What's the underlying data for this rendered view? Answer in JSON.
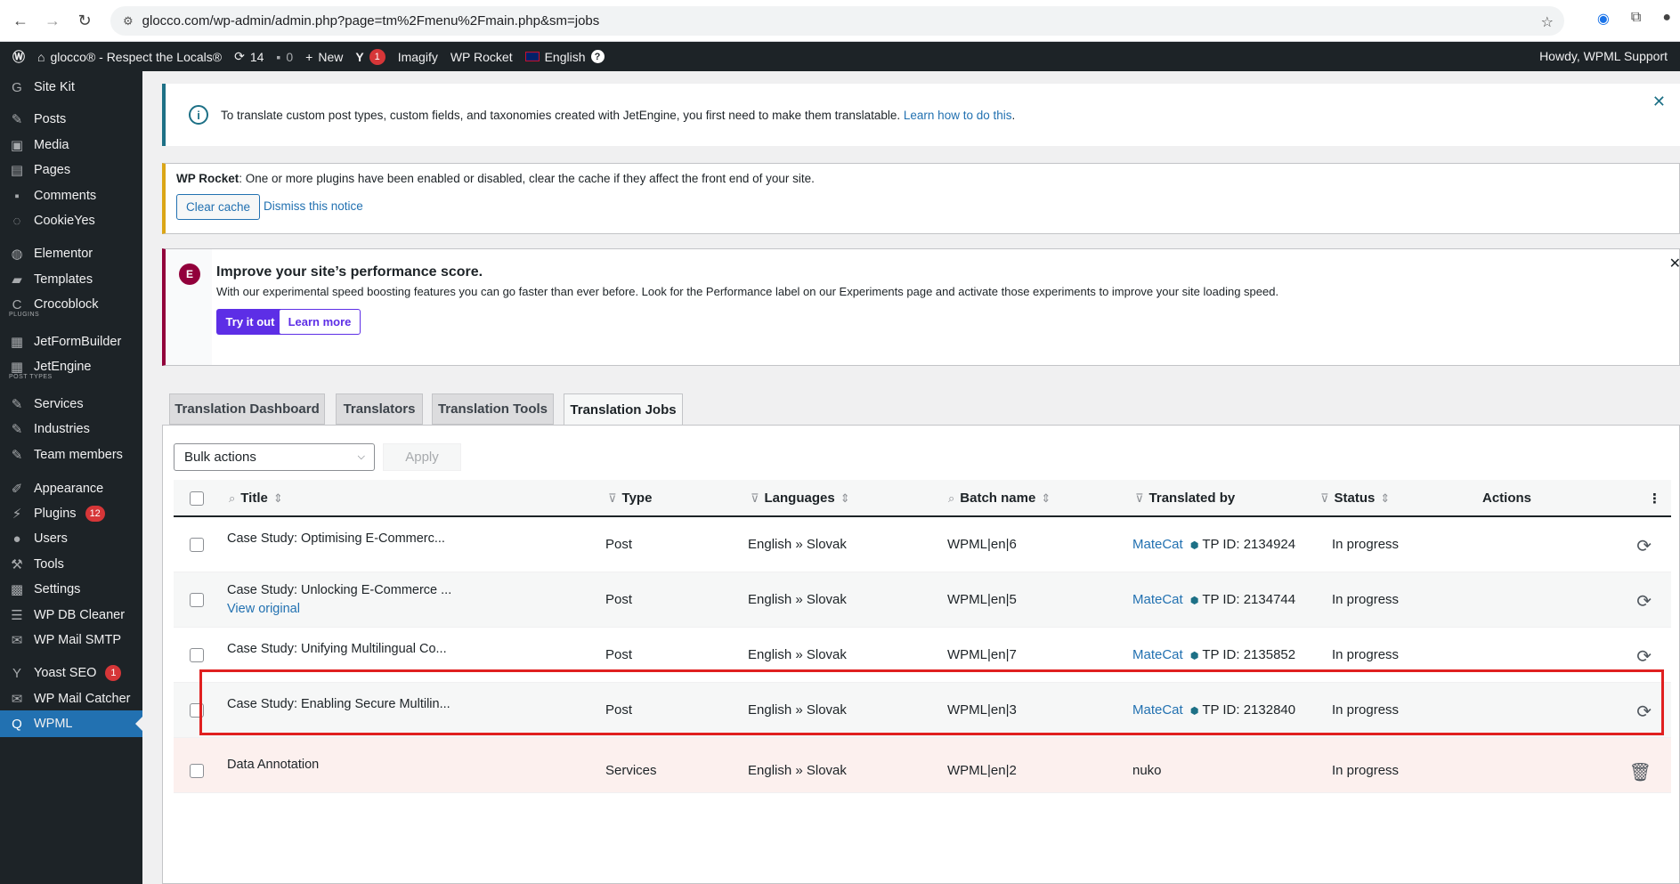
{
  "browser": {
    "url": "glocco.com/wp-admin/admin.php?page=tm%2Fmenu%2Fmain.php&sm=jobs"
  },
  "adminbar": {
    "site_name": "glocco® - Respect the Locals®",
    "updates_count": "14",
    "comments_count": "0",
    "new_label": "New",
    "yoast_badge": "1",
    "imagify": "Imagify",
    "wp_rocket": "WP Rocket",
    "language": "English",
    "howdy": "Howdy, WPML Support"
  },
  "sidebar": {
    "site_kit": "Site Kit",
    "posts": "Posts",
    "media": "Media",
    "pages": "Pages",
    "comments": "Comments",
    "cookieyes": "CookieYes",
    "elementor": "Elementor",
    "templates": "Templates",
    "crocoblock": "Crocoblock",
    "plugins_sep": "PLUGINS",
    "jetformbuilder": "JetFormBuilder",
    "jetengine": "JetEngine",
    "post_types_sep": "POST TYPES",
    "services": "Services",
    "industries": "Industries",
    "team_members": "Team members",
    "appearance": "Appearance",
    "plugins": "Plugins",
    "plugins_badge": "12",
    "users": "Users",
    "tools": "Tools",
    "settings": "Settings",
    "wp_db_cleaner": "WP DB Cleaner",
    "wp_mail_smtp": "WP Mail SMTP",
    "yoast_seo": "Yoast SEO",
    "yoast_badge": "1",
    "wp_mail_catcher": "WP Mail Catcher",
    "wpml": "WPML"
  },
  "notices": {
    "jetengine_text": "To translate custom post types, custom fields, and taxonomies created with JetEngine, you first need to make them translatable.",
    "jetengine_link": "Learn how to do this",
    "rocket_bold": "WP Rocket",
    "rocket_text": ": One or more plugins have been enabled or disabled, clear the cache if they affect the front end of your site.",
    "clear_cache": "Clear cache",
    "dismiss": "Dismiss this notice",
    "elementor_title": "Improve your site’s performance score.",
    "elementor_text": "With our experimental speed boosting features you can go faster than ever before. Look for the Performance label on our Experiments page and activate those experiments to improve your site loading speed.",
    "try_it_out": "Try it out",
    "learn_more": "Learn more"
  },
  "tabs": [
    {
      "label": "Translation Dashboard"
    },
    {
      "label": "Translators"
    },
    {
      "label": "Translation Tools"
    },
    {
      "label": "Translation Jobs"
    }
  ],
  "toolbar": {
    "bulk_actions": "Bulk actions",
    "apply": "Apply"
  },
  "table": {
    "headers": {
      "title": "Title",
      "type": "Type",
      "languages": "Languages",
      "batch": "Batch name",
      "translated_by": "Translated by",
      "status": "Status",
      "actions": "Actions"
    },
    "rows": [
      {
        "title": "Case Study: Optimising E-Commerc...",
        "sub": "",
        "type": "Post",
        "languages": "English » Slovak",
        "batch": "WPML|en|6",
        "translator": "MateCat",
        "tp": "TP ID: 2134924",
        "status": "In progress"
      },
      {
        "title": "Case Study: Unlocking E-Commerce ...",
        "sub": "View original",
        "type": "Post",
        "languages": "English » Slovak",
        "batch": "WPML|en|5",
        "translator": "MateCat",
        "tp": "TP ID: 2134744",
        "status": "In progress"
      },
      {
        "title": "Case Study: Unifying Multilingual Co...",
        "sub": "",
        "type": "Post",
        "languages": "English » Slovak",
        "batch": "WPML|en|7",
        "translator": "MateCat",
        "tp": "TP ID: 2135852",
        "status": "In progress"
      },
      {
        "title": "Case Study: Enabling Secure Multilin...",
        "sub": "",
        "type": "Post",
        "languages": "English » Slovak",
        "batch": "WPML|en|3",
        "translator": "MateCat",
        "tp": "TP ID: 2132840",
        "status": "In progress"
      },
      {
        "title": "Data Annotation",
        "sub": "",
        "type": "Services",
        "languages": "English » Slovak",
        "batch": "WPML|en|2",
        "translator": "nuko",
        "tp": "",
        "status": "In progress"
      }
    ]
  },
  "colors": {
    "wp_blue": "#2271b1",
    "highlight_red": "#e02020",
    "elementor_purple": "#5d2ee6"
  }
}
